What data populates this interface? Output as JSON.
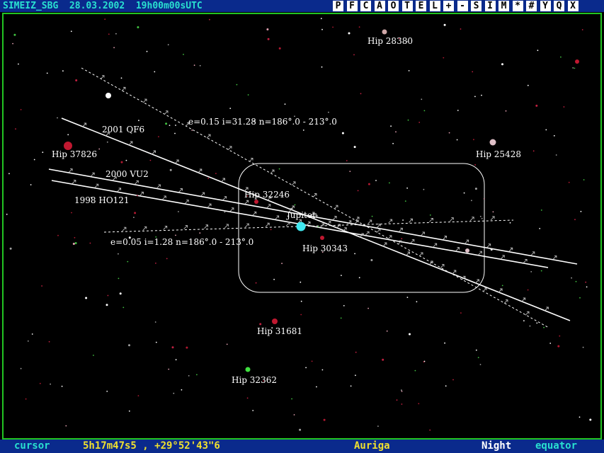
{
  "header": {
    "title": "SIMEIZ_SBG  28.03.2002  19h00m00sUTC",
    "toolbar_buttons": [
      "P",
      "F",
      "C",
      "A",
      "O",
      "T",
      "E",
      "L",
      "+",
      "-",
      "S",
      "I",
      "M",
      "*",
      "#",
      "Y",
      "Q",
      "X"
    ]
  },
  "stars": {
    "hip_28380": "Hip 28380",
    "hip_25428": "Hip 25428",
    "hip_37826": "Hip 37826",
    "hip_32246": "Hip 32246",
    "hip_30343": "Hip 30343",
    "hip_31681": "Hip 31681",
    "hip_32362": "Hip 32362"
  },
  "planet": {
    "name": "Jupiter"
  },
  "orbits": {
    "obj1": "2001 QF6",
    "obj2": "2000 VU2",
    "obj3": "1998 HO121",
    "fan_upper": "e=0.15 i=31.28 n=186°.0 - 213°.0",
    "fan_lower": "e=0.05 i=1.28 n=186°.0 - 213°.0"
  },
  "status": {
    "mode": "cursor",
    "coords": "5h17m47s5 , +29°52'43\"6",
    "constellation": "Auriga",
    "display_mode": "Night",
    "frame": "equator"
  },
  "colors": {
    "bar": "#0a2a8c",
    "title": "#29e0d0",
    "status_text": "#f0e030",
    "frame": "#22c422",
    "jupiter": "#40e8f0"
  }
}
